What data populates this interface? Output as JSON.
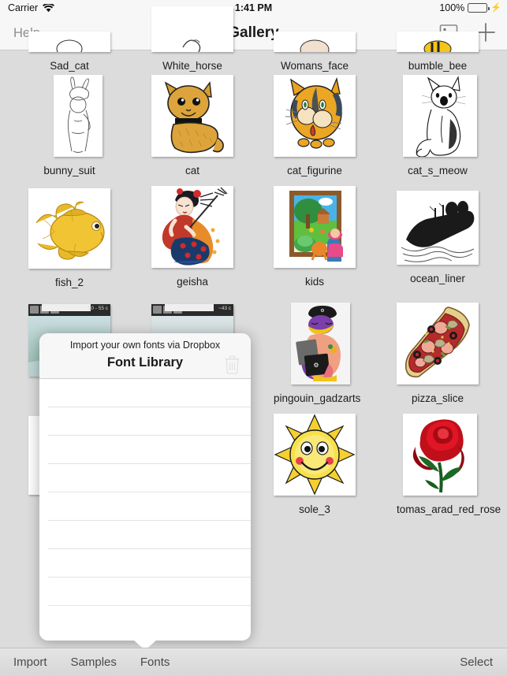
{
  "status_bar": {
    "carrier": "Carrier",
    "wifi_icon": "wifi-icon",
    "time": "1:41 PM",
    "battery_percent": "100%",
    "battery_icon": "battery-icon",
    "charging_icon": "lightning-bolt-icon"
  },
  "nav_bar": {
    "help_label": "Help",
    "title": "Gallery",
    "photo_icon": "photo-library-icon",
    "add_icon": "plus-icon"
  },
  "grid": {
    "row0": [
      {
        "label": "Sad_cat",
        "art": "sad-cat"
      },
      {
        "label": "White_horse",
        "art": "white-horse"
      },
      {
        "label": "Womans_face",
        "art": "womans-face"
      },
      {
        "label": "bumble_bee",
        "art": "bumble-bee"
      }
    ],
    "row1": [
      {
        "label": "bunny_suit",
        "art": "bunny-suit"
      },
      {
        "label": "cat",
        "art": "cat"
      },
      {
        "label": "cat_figurine",
        "art": "cat-figurine"
      },
      {
        "label": "cat_s_meow",
        "art": "cat-s-meow"
      }
    ],
    "row2": [
      {
        "label": "fish_2",
        "art": "fish"
      },
      {
        "label": "geisha",
        "art": "geisha"
      },
      {
        "label": "kids",
        "art": "kids"
      },
      {
        "label": "ocean_liner",
        "art": "ocean-liner"
      }
    ],
    "row3": [
      {
        "label": "",
        "art": "photo-screenshot-1",
        "overlay_text": "50 - 55 c"
      },
      {
        "label": "",
        "art": "photo-screenshot-2",
        "overlay_text": "~43 c"
      },
      {
        "label": "pingouin_gadzarts",
        "art": "penguin"
      },
      {
        "label": "pizza_slice",
        "art": "pizza"
      }
    ],
    "row4": [
      {
        "label": "",
        "art": "hidden-sketch-1"
      },
      {
        "label": "",
        "art": "hidden-sketch-2"
      },
      {
        "label": "sole_3",
        "art": "sun"
      },
      {
        "label": "tomas_arad_red_rose",
        "art": "rose"
      }
    ]
  },
  "popover": {
    "subtitle": "Import your own fonts via Dropbox",
    "title": "Font Library",
    "trash_icon": "trash-icon",
    "row_count": 9,
    "rows": []
  },
  "toolbar": {
    "items": [
      {
        "label": "Import"
      },
      {
        "label": "Samples"
      },
      {
        "label": "Fonts"
      }
    ],
    "select_label": "Select"
  },
  "colors": {
    "background": "#dcdcdc",
    "chrome": "#f7f7f7",
    "battery_green": "#4cd764",
    "text": "#1c1c1c",
    "muted_text": "#8e8e93"
  }
}
